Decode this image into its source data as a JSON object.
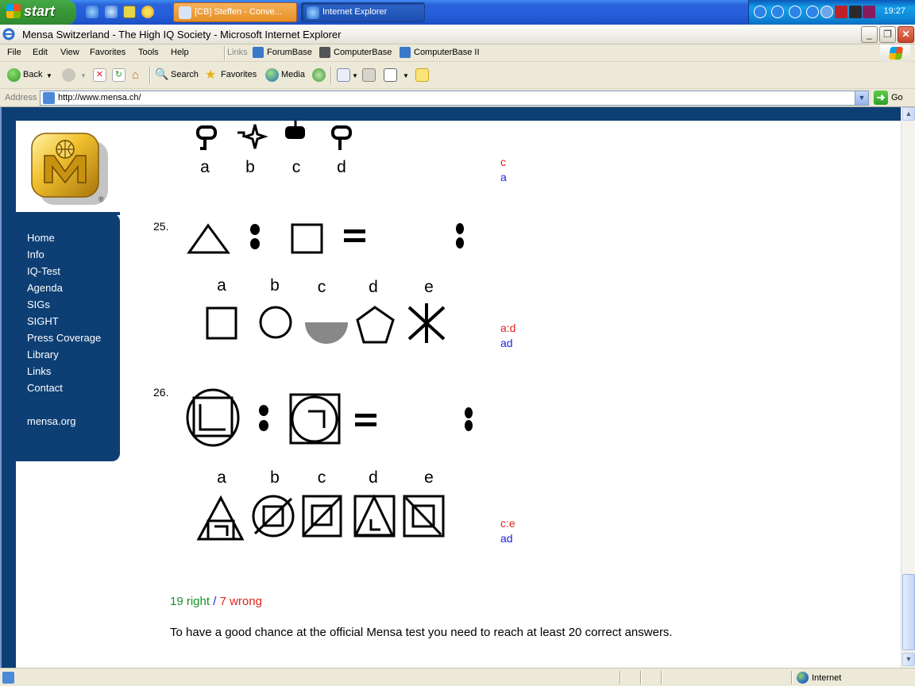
{
  "taskbar": {
    "start_label": "start",
    "tasks": [
      {
        "label": "[CB] Steffen - Conve..."
      },
      {
        "label": "Internet Explorer"
      }
    ],
    "clock": "19:27"
  },
  "window": {
    "title": "Mensa Switzerland - The High IQ Society - Microsoft Internet Explorer"
  },
  "menu": {
    "items": [
      "File",
      "Edit",
      "View",
      "Favorites",
      "Tools",
      "Help"
    ],
    "links_label": "Links",
    "links": [
      "ForumBase",
      "ComputerBase",
      "ComputerBase II"
    ]
  },
  "toolbar": {
    "back_label": "Back",
    "search_label": "Search",
    "favorites_label": "Favorites",
    "media_label": "Media"
  },
  "address": {
    "label": "Address",
    "url": "http://www.mensa.ch/",
    "go_label": "Go"
  },
  "nav": {
    "items": [
      "Home",
      "Info",
      "IQ-Test",
      "Agenda",
      "SIGs",
      "SIGHT",
      "Press Coverage",
      "Library",
      "Links",
      "Contact"
    ],
    "external": "mensa.org"
  },
  "questions": {
    "q24": {
      "options": [
        "a",
        "b",
        "c",
        "d"
      ],
      "given_answer": "c",
      "correct_answer": "a"
    },
    "q25": {
      "number": "25.",
      "options": [
        "a",
        "b",
        "c",
        "d",
        "e"
      ],
      "given_answer": "a:d",
      "correct_answer": "ad"
    },
    "q26": {
      "number": "26.",
      "options": [
        "a",
        "b",
        "c",
        "d",
        "e"
      ],
      "given_answer": "c:e",
      "correct_answer": "ad"
    }
  },
  "result": {
    "right": "19 right",
    "separator": " / ",
    "wrong": "7 wrong",
    "hint": "To have a good chance at the official Mensa test you need to reach at least 20 correct answers."
  },
  "status": {
    "zone": "Internet"
  },
  "colors": {
    "nav_blue": "#0d3f75",
    "answer_red": "#e0221b",
    "answer_blue": "#1f22e0",
    "right_green": "#17912a"
  }
}
